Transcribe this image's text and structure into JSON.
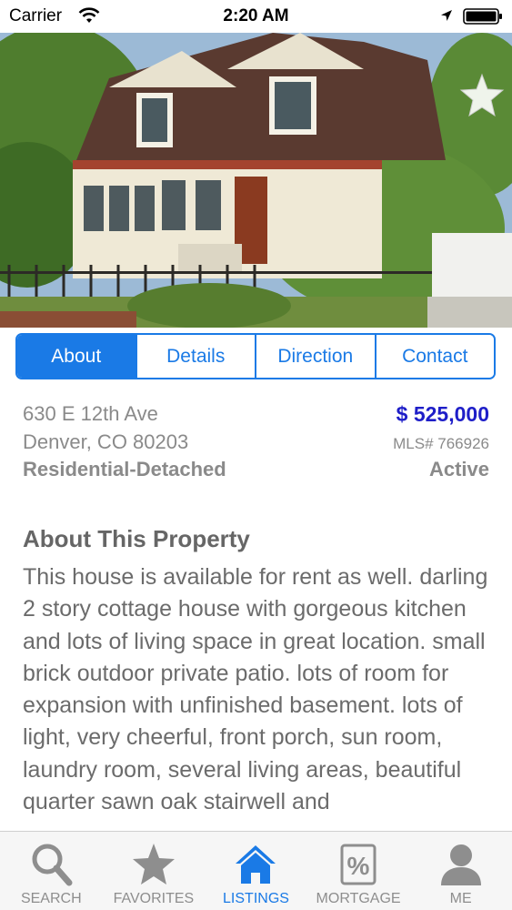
{
  "status_bar": {
    "carrier": "Carrier",
    "time": "2:20 AM"
  },
  "photo": {
    "icon": "favorite-star-icon"
  },
  "segments": [
    {
      "label": "About",
      "active": true
    },
    {
      "label": "Details",
      "active": false
    },
    {
      "label": "Direction",
      "active": false
    },
    {
      "label": "Contact",
      "active": false
    }
  ],
  "listing": {
    "address_line1": "630 E 12th Ave",
    "address_line2": "Denver, CO 80203",
    "property_type": "Residential-Detached",
    "price": "$ 525,000",
    "mls": "MLS# 766926",
    "status": "Active"
  },
  "about": {
    "title": "About This Property",
    "body": "This house is available for rent as well. darling 2 story cottage house with gorgeous kitchen and lots of living space in great location. small brick outdoor private patio. lots of room for expansion with unfinished basement. lots of light, very cheerful, front porch, sun room, laundry room, several living areas, beautiful quarter sawn oak stairwell and"
  },
  "tabs": [
    {
      "label": "SEARCH",
      "icon": "search-icon",
      "active": false
    },
    {
      "label": "FAVORITES",
      "icon": "star-icon",
      "active": false
    },
    {
      "label": "LISTINGS",
      "icon": "home-icon",
      "active": true
    },
    {
      "label": "MORTGAGE",
      "icon": "percent-icon",
      "active": false
    },
    {
      "label": "ME",
      "icon": "person-icon",
      "active": false
    }
  ],
  "colors": {
    "accent": "#1a7ae6",
    "price": "#1e1ec8",
    "text_gray": "#8a8a8a"
  }
}
